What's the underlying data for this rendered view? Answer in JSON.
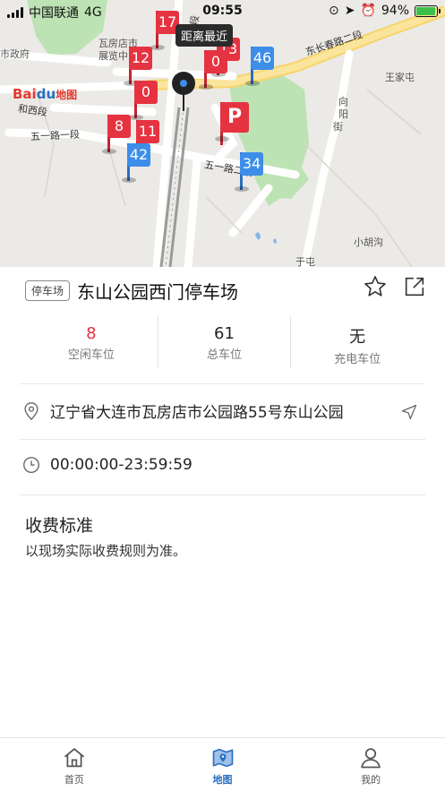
{
  "status_bar": {
    "carrier": "中国联通",
    "network": "4G",
    "time": "09:55",
    "battery": "94%",
    "battery_level": 0.94
  },
  "map": {
    "nearest_label": "距离最近",
    "place_labels": [
      "市政府",
      "瓦房店市",
      "展览中",
      "王家屯",
      "小胡沟",
      "于屯",
      "向",
      "阳",
      "街"
    ],
    "road_labels": [
      "东长春路二段",
      "五一路一段",
      "五一路二段",
      "和西段",
      "二段"
    ],
    "logo": {
      "bai": "Bai",
      "du": "du",
      "map": "地图"
    },
    "markers": [
      {
        "value": "17",
        "type": "parking-red"
      },
      {
        "value": "12",
        "type": "parking-red"
      },
      {
        "value": "13",
        "type": "parking-red"
      },
      {
        "value": "0",
        "type": "parking-red"
      },
      {
        "value": "46",
        "type": "parking-blue"
      },
      {
        "value": "0",
        "type": "parking-red"
      },
      {
        "value": "8",
        "type": "parking-red"
      },
      {
        "value": "11",
        "type": "parking-red"
      },
      {
        "value": "P",
        "type": "parking-red-selected"
      },
      {
        "value": "42",
        "type": "parking-blue"
      },
      {
        "value": "34",
        "type": "parking-blue"
      }
    ]
  },
  "detail": {
    "tag": "停车场",
    "name": "东山公园西门停车场",
    "stats": [
      {
        "value": "8",
        "label": "空闲车位",
        "highlight": true
      },
      {
        "value": "61",
        "label": "总车位",
        "highlight": false
      },
      {
        "value": "无",
        "label": "充电车位",
        "highlight": false
      }
    ],
    "address": "辽宁省大连市瓦房店市公园路55号东山公园",
    "hours": "00:00:00-23:59:59",
    "fee_title": "收费标准",
    "fee_desc": "以现场实际收费规则为准。"
  },
  "tabs": [
    {
      "label": "首页",
      "icon": "home-icon",
      "active": false
    },
    {
      "label": "地图",
      "icon": "map-icon",
      "active": true
    },
    {
      "label": "我的",
      "icon": "user-icon",
      "active": false
    }
  ],
  "colors": {
    "accent": "#2a6fc0",
    "red": "#e53341",
    "blue": "#3c8ee8"
  }
}
